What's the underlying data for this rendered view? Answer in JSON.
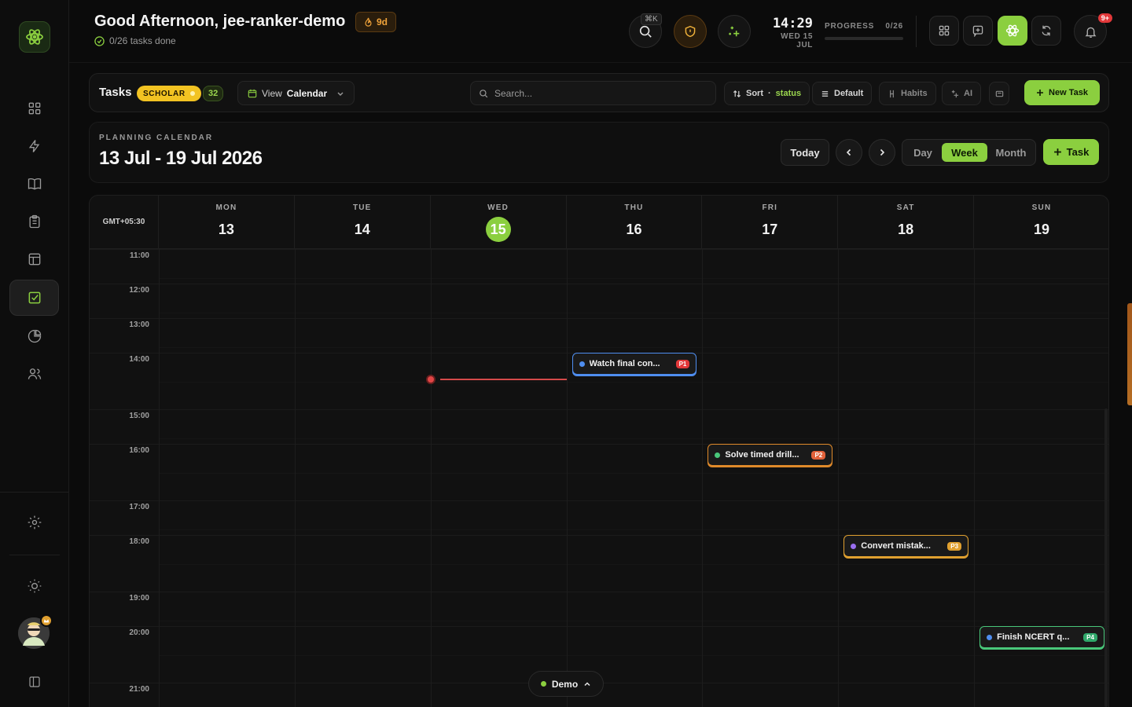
{
  "header": {
    "greeting": "Good Afternoon, jee-ranker-demo",
    "streak": "9d",
    "tasks_done": "0/26 tasks done",
    "shortcut": "⌘K",
    "time": "14:29",
    "date": "WED 15 JUL",
    "progress_label": "PROGRESS",
    "progress_value": "0/26",
    "progress_fraction": 0.0,
    "notification_badge": "9+"
  },
  "toolbar": {
    "title": "Tasks",
    "badge": "SCHOLAR",
    "count": "32",
    "view_prefix": "View",
    "view_value": "Calendar",
    "search_placeholder": "Search...",
    "sort_prefix": "Sort",
    "sort_value": "status",
    "default_label": "Default",
    "habits_label": "Habits",
    "ai_label": "AI",
    "new_task_label": "New Task"
  },
  "calendar": {
    "kicker": "PLANNING CALENDAR",
    "range": "13 Jul - 19 Jul 2026",
    "today_label": "Today",
    "views": [
      "Day",
      "Week",
      "Month"
    ],
    "active_view": "Week",
    "add_task_label": "Task",
    "timezone": "GMT+05:30",
    "days": [
      {
        "name": "MON",
        "date": "13"
      },
      {
        "name": "TUE",
        "date": "14"
      },
      {
        "name": "WED",
        "date": "15",
        "today": true
      },
      {
        "name": "THU",
        "date": "16"
      },
      {
        "name": "FRI",
        "date": "17"
      },
      {
        "name": "SAT",
        "date": "18"
      },
      {
        "name": "SUN",
        "date": "19"
      }
    ],
    "hours": [
      "11:00",
      "12:00",
      "13:00",
      "14:00",
      "15:00",
      "16:00",
      "17:00",
      "18:00",
      "19:00",
      "20:00",
      "21:00"
    ],
    "events": [
      {
        "title": "Watch final con...",
        "priority": "P1",
        "day": "THU",
        "time": "14:00",
        "dot": "#4f8ef0",
        "border": "#4f8ef0",
        "prio_color": "#e2383a"
      },
      {
        "title": "Solve timed drill...",
        "priority": "P2",
        "day": "FRI",
        "time": "16:00",
        "dot": "#49c77a",
        "border": "#e08a2a",
        "prio_color": "#e2613a"
      },
      {
        "title": "Convert mistak...",
        "priority": "P3",
        "day": "SAT",
        "time": "18:00",
        "dot": "#9a6ff0",
        "border": "#e0a030",
        "prio_color": "#e0a030"
      },
      {
        "title": "Finish NCERT q...",
        "priority": "P4",
        "day": "SUN",
        "time": "20:00",
        "dot": "#4f8ef0",
        "border": "#49c77a",
        "prio_color": "#2fa86a"
      }
    ]
  },
  "demo_label": "Demo",
  "colors": {
    "accent": "#8bcf3f",
    "now_line": "#d44a4a",
    "background": "#0b0b0b"
  }
}
